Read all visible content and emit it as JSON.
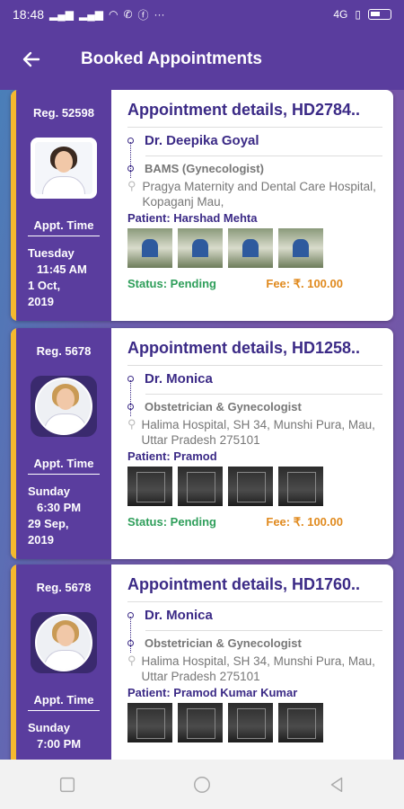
{
  "status_bar": {
    "time": "18:48",
    "network": "4G"
  },
  "app_bar": {
    "title": "Booked Appointments"
  },
  "appointments": [
    {
      "reg": "Reg. 52598",
      "title": "Appointment details, HD2784..",
      "doctor": "Dr. Deepika Goyal",
      "degree": "BAMS (Gynecologist)",
      "address": "Pragya Maternity and Dental Care Hospital, Kopaganj Mau,",
      "patient": "Patient: Harshad Mehta",
      "appt_label": "Appt. Time",
      "day": "Tuesday",
      "time": "11:45 AM",
      "date_line1": "1 Oct,",
      "date_line2": "2019",
      "status": "Status: Pending",
      "fee": "Fee: ₹. 100.00"
    },
    {
      "reg": "Reg. 5678",
      "title": "Appointment details, HD1258..",
      "doctor": "Dr. Monica",
      "degree": "Obstetrician & Gynecologist",
      "address": "Halima Hospital, SH 34, Munshi Pura, Mau, Uttar Pradesh 275101",
      "patient": "Patient: Pramod",
      "appt_label": "Appt. Time",
      "day": "Sunday",
      "time": "6:30 PM",
      "date_line1": "29 Sep,",
      "date_line2": "2019",
      "status": "Status: Pending",
      "fee": "Fee: ₹. 100.00"
    },
    {
      "reg": "Reg. 5678",
      "title": "Appointment details, HD1760..",
      "doctor": "Dr. Monica",
      "degree": "Obstetrician & Gynecologist",
      "address": "Halima Hospital, SH 34, Munshi Pura, Mau, Uttar Pradesh 275101",
      "patient": "Patient: Pramod Kumar Kumar",
      "appt_label": "Appt. Time",
      "day": "Sunday",
      "time": "7:00 PM"
    }
  ],
  "colors": {
    "primary": "#5a3d9e",
    "accent_stripe": "#f5b82e",
    "status_green": "#2e9e5a",
    "fee_orange": "#e08a1e",
    "title_purple": "#3b2a86"
  }
}
